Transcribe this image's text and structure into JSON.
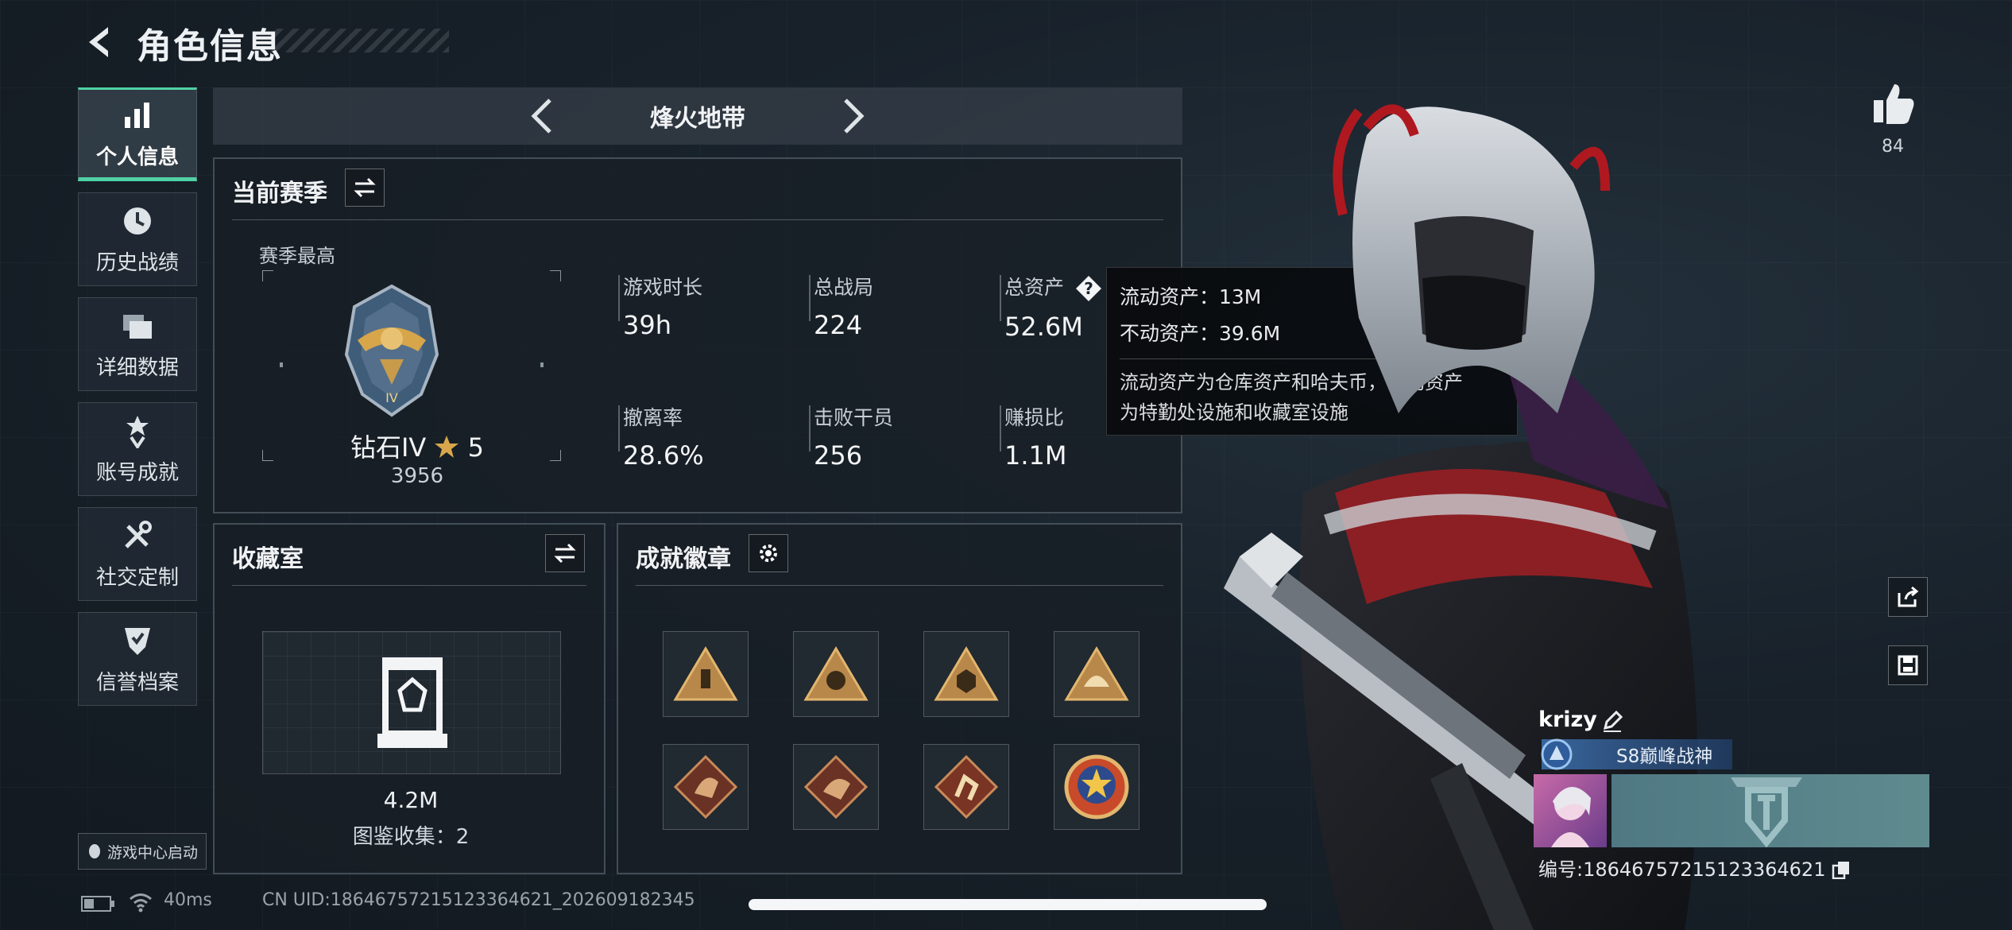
{
  "header": {
    "title": "角色信息"
  },
  "nav": {
    "items": [
      {
        "label": "个人信息",
        "icon": "bar-chart-icon",
        "active": true
      },
      {
        "label": "历史战绩",
        "icon": "clock-icon",
        "active": false
      },
      {
        "label": "详细数据",
        "icon": "folders-icon",
        "active": false
      },
      {
        "label": "账号成就",
        "icon": "medal-icon",
        "active": false
      },
      {
        "label": "社交定制",
        "icon": "tools-icon",
        "active": false
      },
      {
        "label": "信誉档案",
        "icon": "shield-check-icon",
        "active": false
      }
    ],
    "game_center": "游戏中心启动"
  },
  "mode": {
    "title": "烽火地带"
  },
  "season": {
    "title": "当前赛季",
    "sub_label": "赛季最高",
    "rank_name": "钻石IV",
    "rank_stars": "5",
    "rank_score": "3956",
    "stats": [
      {
        "label": "游戏时长",
        "value": "39h"
      },
      {
        "label": "总战局",
        "value": "224"
      },
      {
        "label": "总资产",
        "value": "52.6M"
      },
      {
        "label": "撤离率",
        "value": "28.6%"
      },
      {
        "label": "击败干员",
        "value": "256"
      },
      {
        "label": "赚损比",
        "value": "1.1M"
      }
    ]
  },
  "tooltip": {
    "liquid": "流动资产：13M",
    "fixed": "不动资产：39.6M",
    "desc_line1": "流动资产为仓库资产和哈夫币，不动资产",
    "desc_line2": "为特勤处设施和收藏室设施"
  },
  "collection": {
    "title": "收藏室",
    "value": "4.2M",
    "count": "图鉴收集：2"
  },
  "badges": {
    "title": "成就徽章"
  },
  "likes": {
    "count": "84"
  },
  "player": {
    "name": "krizy",
    "title": "S8巅峰战神",
    "id": "编号:18646757215123364621"
  },
  "status": {
    "ping": "40ms",
    "uid": "CN UID:18646757215123364621_202609182345"
  },
  "colors": {
    "accent": "#4fd1a5",
    "gold": "#d8a64a",
    "panel_border": "#78879480"
  }
}
